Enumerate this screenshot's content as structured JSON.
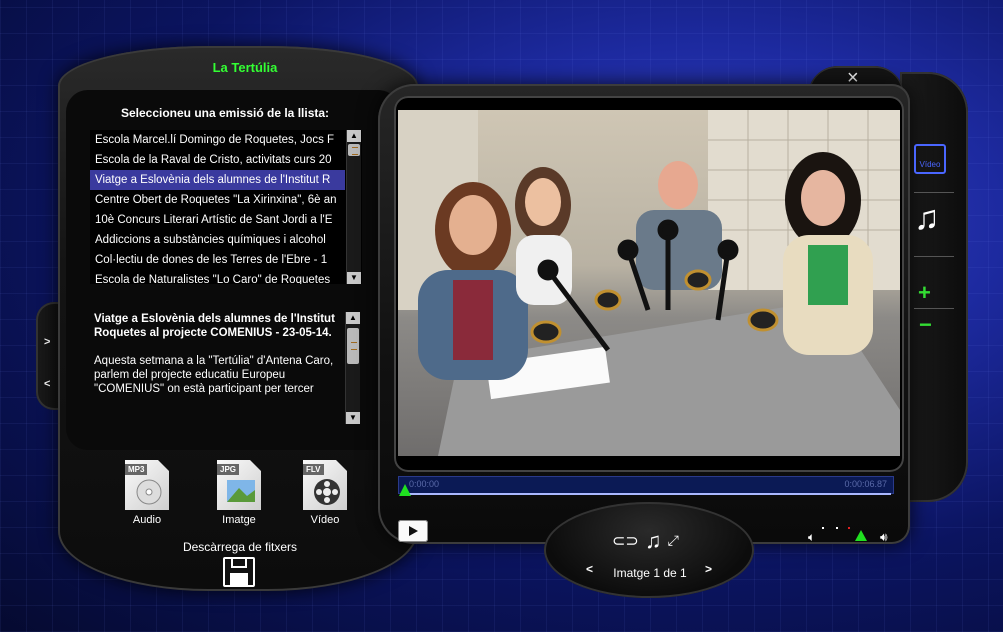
{
  "window": {
    "close_label": "×"
  },
  "program": {
    "title": "La Tertúlia"
  },
  "list": {
    "header": "Seleccioneu una emissió de la llista:",
    "items": [
      "Escola Marcel.lí Domingo de Roquetes, Jocs F",
      "Escola de la Raval de Cristo, activitats curs 20",
      "Viatge a Eslovènia dels alumnes de l'Institut R",
      "Centre Obert de Roquetes \"La Xirinxina\", 6è an",
      "10è Concurs Literari Artístic de Sant Jordi a l'E",
      "Addiccions a substàncies químiques i alcohol",
      "Col·lectiu de dones de les Terres de l'Ebre - 1",
      "Escola de Naturalistes \"Lo Caro\" de Roquetes"
    ],
    "selected_index": 2
  },
  "description": {
    "title": "Viatge a Eslovènia dels alumnes de l'Institut Roquetes al projecte COMENIUS - 23-05-14.",
    "body": "Aquesta setmana a la \"Tertúlia\" d'Antena Caro, parlem del projecte educatiu Europeu \"COMENIUS\" on està participant per tercer"
  },
  "side_nav": {
    "next": ">",
    "prev": "<"
  },
  "downloads": {
    "label": "Descàrrega de fitxers",
    "items": [
      {
        "tag": "MP3",
        "label": "Audio"
      },
      {
        "tag": "JPG",
        "label": "Imatge"
      },
      {
        "tag": "FLV",
        "label": "Vídeo"
      }
    ]
  },
  "player": {
    "time_elapsed": "0:00:00",
    "time_total": "0:00:06.87",
    "image_counter": "Imatge 1 de 1",
    "prev_label": "<",
    "next_label": ">"
  },
  "rail": {
    "video_label": "Vídeo",
    "plus": "+",
    "minus": "−"
  },
  "colors": {
    "accent_green": "#33ff33",
    "selection": "#3a3a9e",
    "video_blue": "#4a66ff"
  }
}
